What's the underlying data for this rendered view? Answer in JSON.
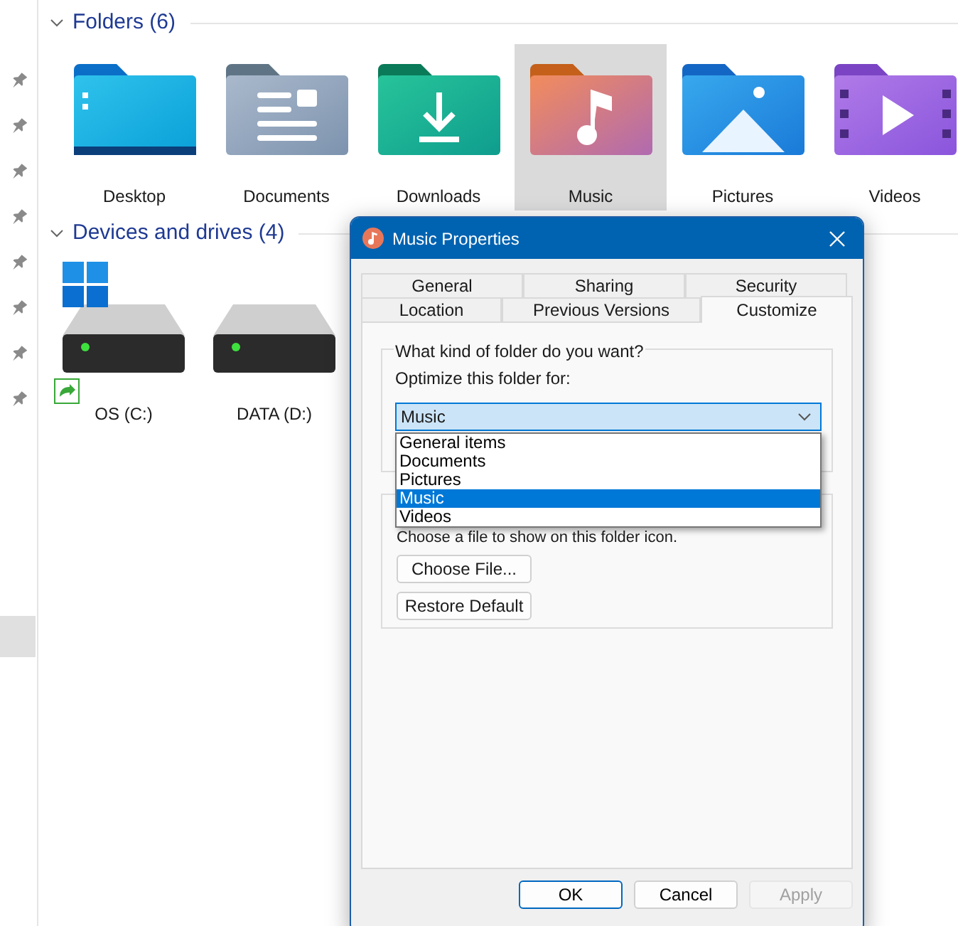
{
  "sections": [
    {
      "title": "Folders (6)",
      "expanded": true,
      "items": [
        {
          "label": "Desktop",
          "kind": "desktop",
          "selected": false
        },
        {
          "label": "Documents",
          "kind": "documents",
          "selected": false
        },
        {
          "label": "Downloads",
          "kind": "downloads",
          "selected": false
        },
        {
          "label": "Music",
          "kind": "music",
          "selected": true
        },
        {
          "label": "Pictures",
          "kind": "pictures",
          "selected": false
        },
        {
          "label": "Videos",
          "kind": "videos",
          "selected": false
        }
      ]
    },
    {
      "title": "Devices and drives (4)",
      "expanded": true,
      "items": [
        {
          "label": "OS (C:)",
          "kind": "system_drive",
          "selected": false
        },
        {
          "label": "DATA (D:)",
          "kind": "drive",
          "selected": false
        }
      ]
    }
  ],
  "dialog": {
    "title": "Music Properties",
    "tab_rows": [
      [
        {
          "label": "General",
          "selected": false
        },
        {
          "label": "Sharing",
          "selected": false
        },
        {
          "label": "Security",
          "selected": false
        }
      ],
      [
        {
          "label": "Location",
          "selected": false
        },
        {
          "label": "Previous Versions",
          "selected": false
        },
        {
          "label": "Customize",
          "selected": true
        }
      ]
    ],
    "folder_type": {
      "legend": "What kind of folder do you want?",
      "label": "Optimize this folder for:",
      "value": "Music",
      "open": true,
      "options": [
        {
          "label": "General items",
          "selected": false
        },
        {
          "label": "Documents",
          "selected": false
        },
        {
          "label": "Pictures",
          "selected": false
        },
        {
          "label": "Music",
          "selected": true
        },
        {
          "label": "Videos",
          "selected": false
        }
      ]
    },
    "folder_icon": {
      "text": "Choose a file to show on this folder icon.",
      "buttons": [
        "Choose File...",
        "Restore Default"
      ]
    },
    "buttons": [
      {
        "label": "OK",
        "default": true,
        "disabled": false
      },
      {
        "label": "Cancel",
        "default": false,
        "disabled": false
      },
      {
        "label": "Apply",
        "default": false,
        "disabled": true
      }
    ]
  }
}
